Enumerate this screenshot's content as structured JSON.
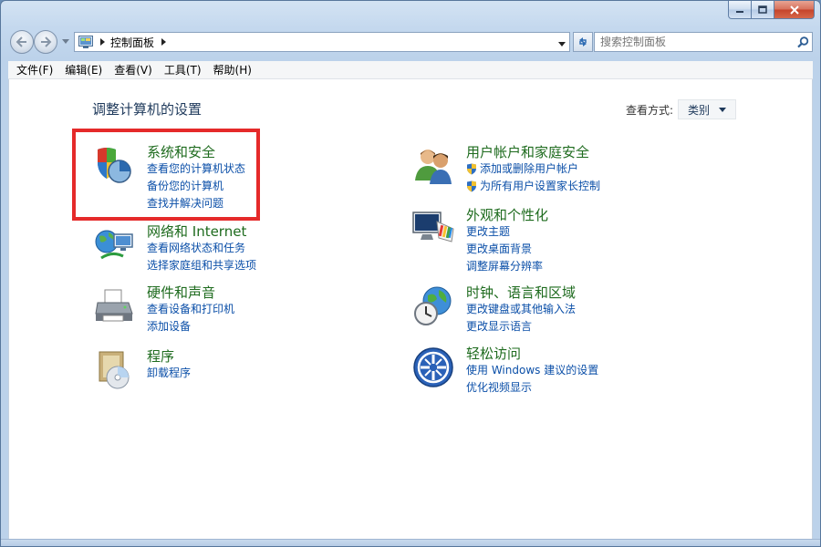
{
  "window": {
    "caption_buttons": [
      "minimize",
      "maximize",
      "close"
    ]
  },
  "navbar": {
    "address_crumbs": [
      "控制面板"
    ],
    "search_placeholder": "搜索控制面板"
  },
  "menu": [
    "文件(F)",
    "编辑(E)",
    "查看(V)",
    "工具(T)",
    "帮助(H)"
  ],
  "main": {
    "title": "调整计算机的设置",
    "view_by_label": "查看方式:",
    "view_by_value": "类别"
  },
  "categories": [
    {
      "title": "系统和安全",
      "icon": "shield-computer-icon",
      "links": [
        "查看您的计算机状态",
        "备份您的计算机",
        "查找并解决问题"
      ]
    },
    {
      "title": "网络和 Internet",
      "icon": "network-globe-icon",
      "links": [
        "查看网络状态和任务",
        "选择家庭组和共享选项"
      ]
    },
    {
      "title": "硬件和声音",
      "icon": "printer-icon",
      "links": [
        "查看设备和打印机",
        "添加设备"
      ]
    },
    {
      "title": "程序",
      "icon": "programs-disc-icon",
      "links": [
        "卸载程序"
      ]
    },
    {
      "title": "用户帐户和家庭安全",
      "icon": "users-icon",
      "links": [
        "添加或删除用户帐户",
        "为所有用户设置家长控制"
      ],
      "link_shields": [
        true,
        true
      ]
    },
    {
      "title": "外观和个性化",
      "icon": "monitor-palette-icon",
      "links": [
        "更改主题",
        "更改桌面背景",
        "调整屏幕分辨率"
      ]
    },
    {
      "title": "时钟、语言和区域",
      "icon": "clock-globe-icon",
      "links": [
        "更改键盘或其他输入法",
        "更改显示语言"
      ]
    },
    {
      "title": "轻松访问",
      "icon": "ease-of-access-icon",
      "links": [
        "使用 Windows 建议的设置",
        "优化视频显示"
      ]
    }
  ],
  "colors": {
    "category_title": "#1e6b1e",
    "link": "#0b4fa8",
    "highlight": "#e52a2a",
    "page_title": "#1e395b"
  }
}
